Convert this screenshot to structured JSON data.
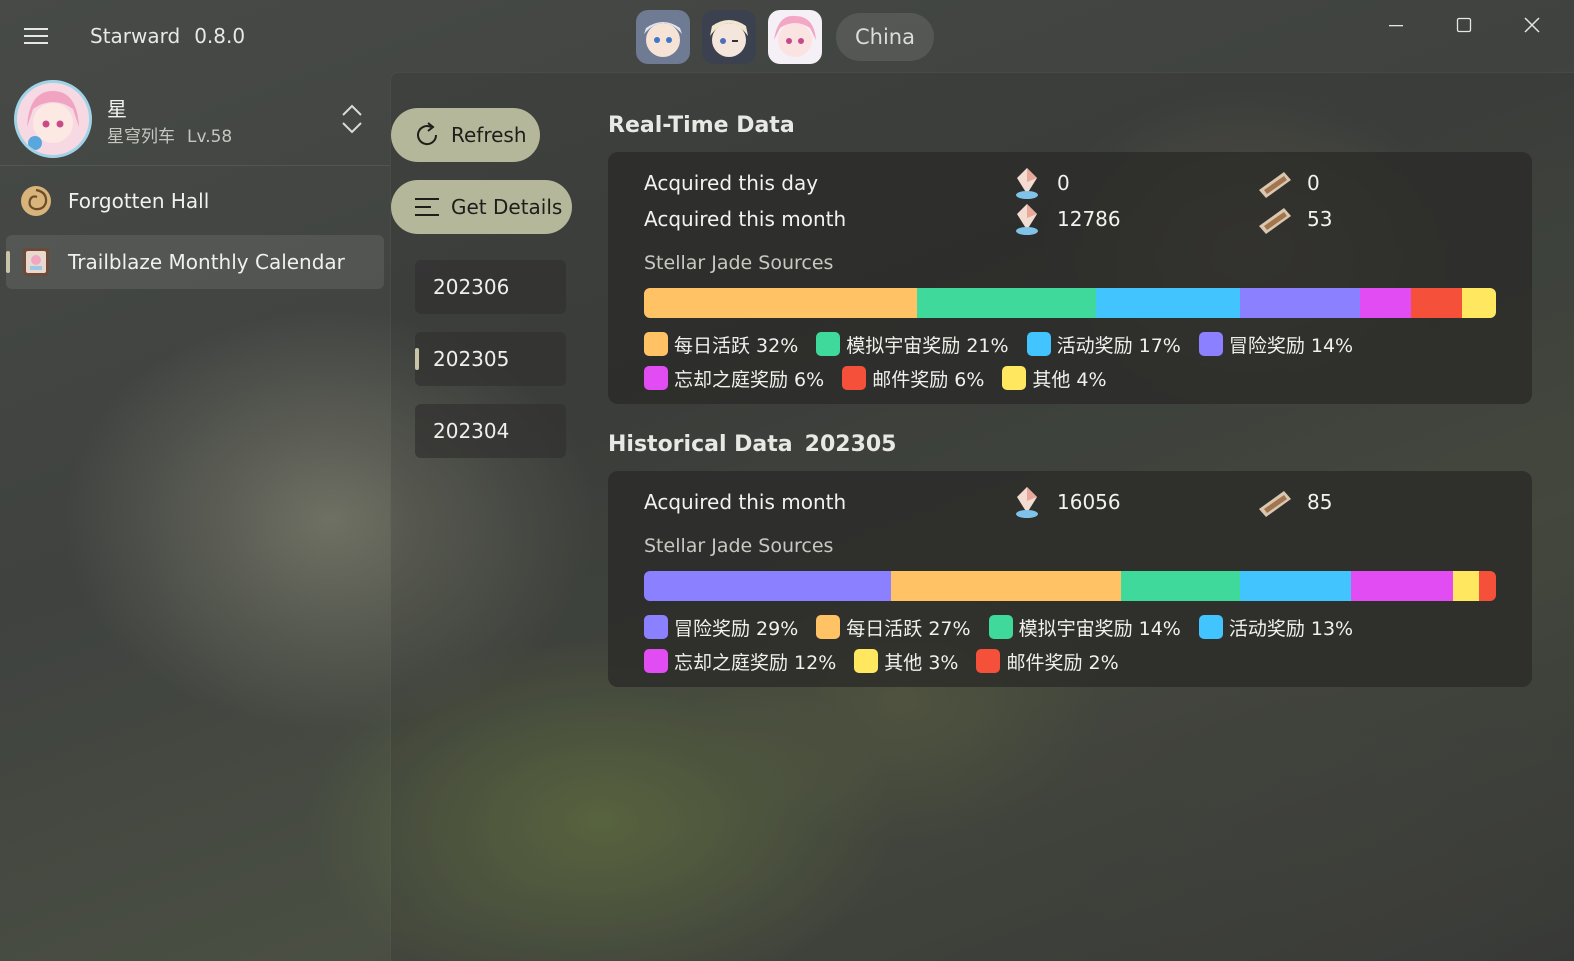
{
  "app": {
    "title": "Starward",
    "version": "0.8.0"
  },
  "server": "China",
  "colors": {
    "每日活跃": "#ffc366",
    "模拟宇宙奖励": "#3ed99b",
    "活动奖励": "#42c4ff",
    "冒险奖励": "#8b80ff",
    "忘却之庭奖励": "#e24cf3",
    "邮件奖励": "#f5513a",
    "其他": "#ffe860",
    "button": "#b5b79a"
  },
  "account": {
    "name": "星",
    "game": "星穹列车",
    "level": "Lv.58"
  },
  "nav": {
    "items": [
      {
        "label": "Forgotten Hall",
        "icon": "forgotten-hall-icon",
        "selected": false
      },
      {
        "label": "Trailblaze Monthly Calendar",
        "icon": "calendar-icon",
        "selected": true
      }
    ]
  },
  "actions": {
    "refresh": "Refresh",
    "details": "Get Details"
  },
  "months": [
    {
      "label": "202306",
      "selected": false
    },
    {
      "label": "202305",
      "selected": true
    },
    {
      "label": "202304",
      "selected": false
    }
  ],
  "realtime": {
    "title": "Real-Time Data",
    "day_label": "Acquired this day",
    "day_jade": "0",
    "day_pass": "0",
    "month_label": "Acquired this month",
    "month_jade": "12786",
    "month_pass": "53",
    "sources_label": "Stellar Jade Sources",
    "sources": [
      {
        "name": "每日活跃",
        "percent": 32
      },
      {
        "name": "模拟宇宙奖励",
        "percent": 21
      },
      {
        "name": "活动奖励",
        "percent": 17
      },
      {
        "name": "冒险奖励",
        "percent": 14
      },
      {
        "name": "忘却之庭奖励",
        "percent": 6
      },
      {
        "name": "邮件奖励",
        "percent": 6
      },
      {
        "name": "其他",
        "percent": 4
      }
    ]
  },
  "historical": {
    "title": "Historical Data",
    "month": "202305",
    "month_label": "Acquired this month",
    "month_jade": "16056",
    "month_pass": "85",
    "sources_label": "Stellar Jade Sources",
    "sources": [
      {
        "name": "冒险奖励",
        "percent": 29
      },
      {
        "name": "每日活跃",
        "percent": 27
      },
      {
        "name": "模拟宇宙奖励",
        "percent": 14
      },
      {
        "name": "活动奖励",
        "percent": 13
      },
      {
        "name": "忘却之庭奖励",
        "percent": 12
      },
      {
        "name": "其他",
        "percent": 3
      },
      {
        "name": "邮件奖励",
        "percent": 2
      }
    ]
  }
}
